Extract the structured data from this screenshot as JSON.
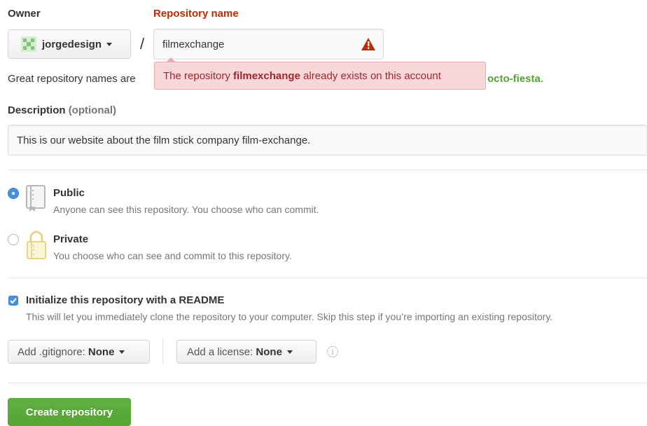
{
  "owner": {
    "label": "Owner",
    "name": "jorgedesign"
  },
  "separator": "/",
  "repo": {
    "label": "Repository name",
    "value": "filmexchange"
  },
  "tooltip": {
    "before": "The repository ",
    "bold": "filmexchange",
    "after": " already exists on this account"
  },
  "hint": {
    "visible_prefix": "Great repository names are",
    "visible_suffix": "octo-fiesta",
    "period": "."
  },
  "description": {
    "label": "Description",
    "optional": "(optional)",
    "value": "This is our website about the film stick company film-exchange."
  },
  "visibility": {
    "public": {
      "title": "Public",
      "desc": "Anyone can see this repository. You choose who can commit.",
      "selected": true
    },
    "private": {
      "title": "Private",
      "desc": "You choose who can see and commit to this repository.",
      "selected": false
    }
  },
  "readme": {
    "title": "Initialize this repository with a README",
    "desc": "This will let you immediately clone the repository to your computer. Skip this step if you’re importing an existing repository.",
    "checked": true
  },
  "gitignore": {
    "prefix": "Add .gitignore: ",
    "value": "None"
  },
  "license": {
    "prefix": "Add a license: ",
    "value": "None"
  },
  "info_icon": "i",
  "create_button": "Create repository",
  "colors": {
    "error": "#bd2c00",
    "tooltip_bg": "#f8d7da",
    "green": "#55a532",
    "radio_blue": "#4a90e2"
  }
}
